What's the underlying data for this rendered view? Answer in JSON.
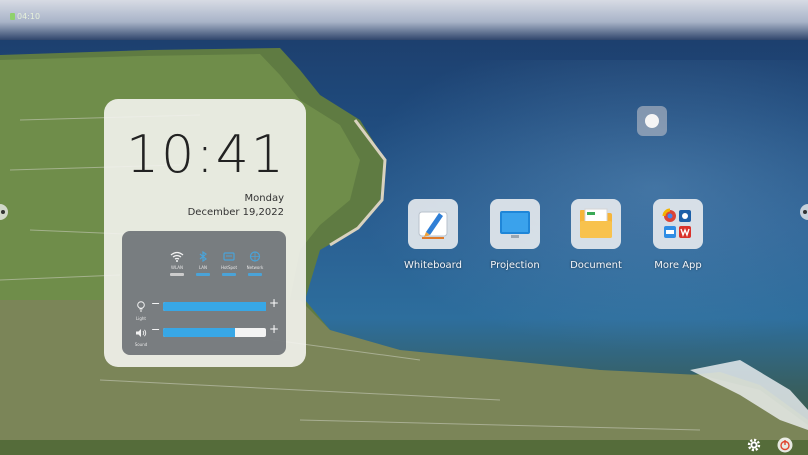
{
  "status_bar": {
    "time": "04:10"
  },
  "widget": {
    "time": "10:41",
    "day": "Monday",
    "date": "December 19,2022",
    "toggles": [
      {
        "label": "WLAN",
        "icon": "wifi-icon",
        "on": false
      },
      {
        "label": "LAN",
        "icon": "bluetooth-icon",
        "on": true
      },
      {
        "label": "HotSpot",
        "icon": "hotspot-icon",
        "on": true
      },
      {
        "label": "Network",
        "icon": "network-icon",
        "on": true
      }
    ],
    "sliders": [
      {
        "label": "Light",
        "icon": "light-bulb-icon",
        "level_percent": 100
      },
      {
        "label": "Sound",
        "icon": "speaker-icon",
        "level_percent": 70
      }
    ],
    "minus": "−",
    "plus": "+"
  },
  "apps": [
    {
      "label": "Whiteboard",
      "icon": "whiteboard-pen-icon"
    },
    {
      "label": "Projection",
      "icon": "projection-screen-icon"
    },
    {
      "label": "Document",
      "icon": "document-folder-icon"
    },
    {
      "label": "More App",
      "icon": "more-apps-grid-icon"
    }
  ],
  "colors": {
    "accent": "#38a7e6",
    "widget_bg": "#f4f4f0",
    "control_panel_bg": "#5c6268"
  }
}
